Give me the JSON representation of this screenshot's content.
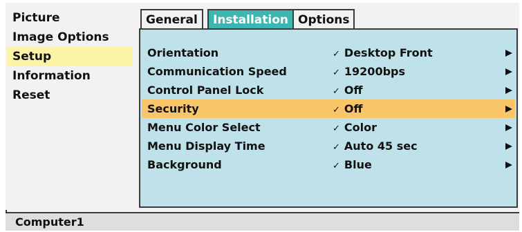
{
  "nav": {
    "items": [
      {
        "label": "Picture"
      },
      {
        "label": "Image Options"
      },
      {
        "label": "Setup"
      },
      {
        "label": "Information"
      },
      {
        "label": "Reset"
      }
    ],
    "selected_index": 2
  },
  "tabs": [
    {
      "label": "General"
    },
    {
      "label": "Installation"
    },
    {
      "label": "Options"
    }
  ],
  "active_tab_index": 1,
  "check_glyph": "✓",
  "menu": {
    "rows": [
      {
        "label": "Orientation",
        "value": "Desktop Front"
      },
      {
        "label": "Communication Speed",
        "value": "19200bps"
      },
      {
        "label": "Control Panel Lock",
        "value": "Off"
      },
      {
        "label": "Security",
        "value": "Off"
      },
      {
        "label": "Menu Color Select",
        "value": "Color"
      },
      {
        "label": "Menu Display Time",
        "value": "Auto 45 sec"
      },
      {
        "label": "Background",
        "value": "Blue"
      }
    ],
    "selected_index": 3
  },
  "status": {
    "source": "Computer1"
  },
  "colors": {
    "active_tab": "#3fb5b0",
    "panel_bg": "#bfe1e9",
    "selected_row": "#f8c569",
    "selected_nav": "#fbf3a8"
  }
}
